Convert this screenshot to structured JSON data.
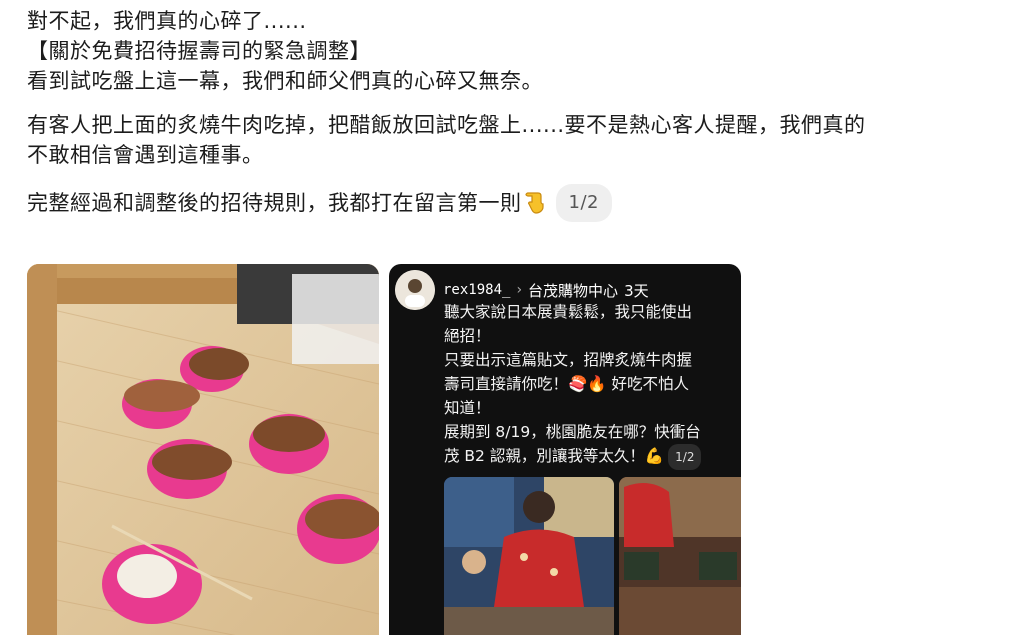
{
  "post": {
    "line1": "對不起，我們真的心碎了......",
    "line2": "【關於免費招待握壽司的緊急調整】",
    "line3": "看到試吃盤上這一幕，我們和師父們真的心碎又無奈。",
    "line4": "有客人把上面的炙燒牛肉吃掉，把醋飯放回試吃盤上......要不是熱心客人提醒，我們真的",
    "line5": "不敢相信會遇到這種事。",
    "line6": "完整經過和調整後的招待規則，我都打在留言第一則",
    "line6_emoji": "pointing-down-emoji",
    "image_counter": "1/2"
  },
  "left_photo": {
    "description_icon": "sushi-tray-photo"
  },
  "ig_screenshot": {
    "username": "rex1984_",
    "separator": "›",
    "location": "台茂購物中心",
    "time": "3天",
    "caption_lines": [
      "聽大家說日本展貴鬆鬆，我只能使出",
      "絕招！",
      "只要出示這篇貼文，招牌炙燒牛肉握",
      "壽司直接請你吃！🍣🔥 好吃不怕人",
      "知道！",
      "展期到 8/19，桃園脆友在哪？快衝台",
      "茂 B2 認親，別讓我等太久！💪"
    ],
    "counter": "1/2"
  }
}
